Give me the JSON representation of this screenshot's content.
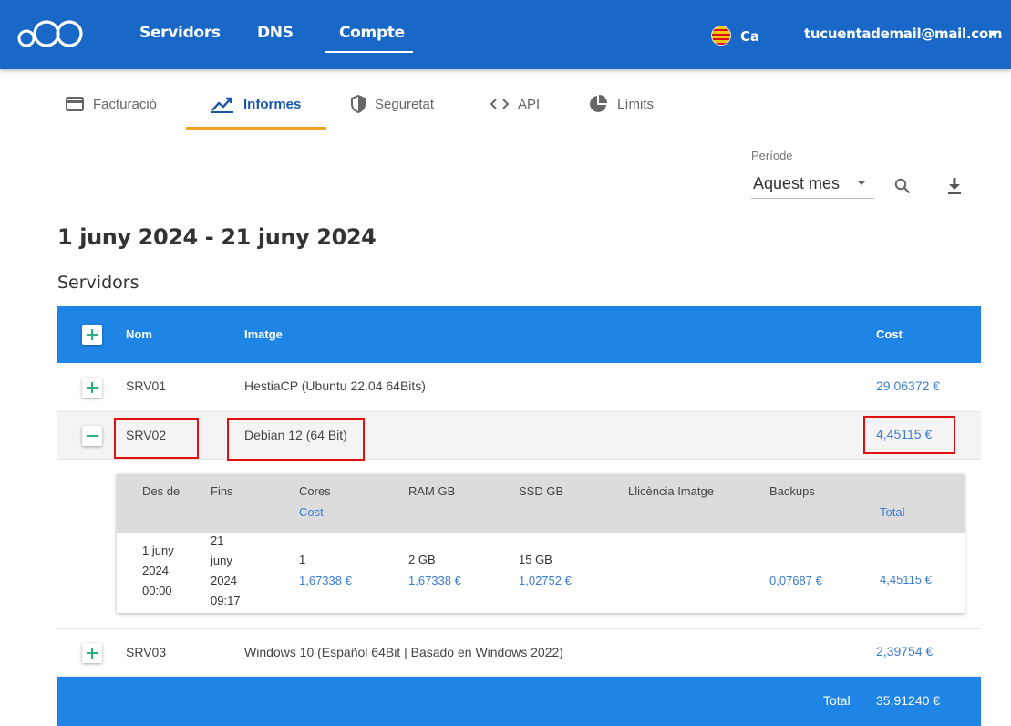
{
  "nav": {
    "items": [
      "Servidors",
      "DNS",
      "Compte"
    ],
    "language": "Ca",
    "account_email": "tucuentademail@mail.com"
  },
  "subtabs": [
    {
      "label": "Facturació",
      "icon": "credit-card-icon"
    },
    {
      "label": "Informes",
      "icon": "trending-up-icon",
      "active": true
    },
    {
      "label": "Seguretat",
      "icon": "shield-icon"
    },
    {
      "label": "API",
      "icon": "code-icon"
    },
    {
      "label": "Límits",
      "icon": "pie-chart-icon"
    }
  ],
  "filter": {
    "period_label": "Període",
    "period_value": "Aquest mes"
  },
  "date_range": "1 juny 2024 - 21 juny 2024",
  "section_title": "Servidors",
  "table": {
    "headers": {
      "name": "Nom",
      "image": "Imatge",
      "cost": "Cost"
    },
    "rows": [
      {
        "name": "SRV01",
        "image": "HestiaCP (Ubuntu 22.04 64Bits)",
        "cost": "29,06372 €",
        "expanded": false
      },
      {
        "name": "SRV02",
        "image": "Debian 12 (64 Bit)",
        "cost": "4,45115 €",
        "expanded": true
      },
      {
        "name": "SRV03",
        "image": "Windows 10 (Español 64Bit | Basado en Windows 2022)",
        "cost": "2,39754 €",
        "expanded": false
      }
    ],
    "footer": {
      "label": "Total",
      "value": "35,91240 €"
    }
  },
  "detail": {
    "headers": {
      "from": "Des de",
      "to": "Fins",
      "cores": "Cores",
      "cost_sub": "Cost",
      "ram": "RAM GB",
      "ssd": "SSD GB",
      "license": "Llicència Imatge",
      "backups": "Backups",
      "total": "Total"
    },
    "row": {
      "from_lines": [
        "1 juny",
        "2024",
        "00:00"
      ],
      "to_lines": [
        "21",
        "juny",
        "2024",
        "09:17"
      ],
      "cores": "1",
      "cores_cost": "1,67338 €",
      "ram": "2 GB",
      "ram_cost": "1,67338 €",
      "ssd": "15 GB",
      "ssd_cost": "1,02752 €",
      "backups_cost": "0,07687 €",
      "total": "4,45115 €"
    }
  },
  "colors": {
    "topbar": "#1967c6",
    "table_header": "#1e85e6",
    "active_tab_underline": "#f0a226",
    "highlight_box": "#e01010",
    "cost_link": "#3a7bd5"
  }
}
